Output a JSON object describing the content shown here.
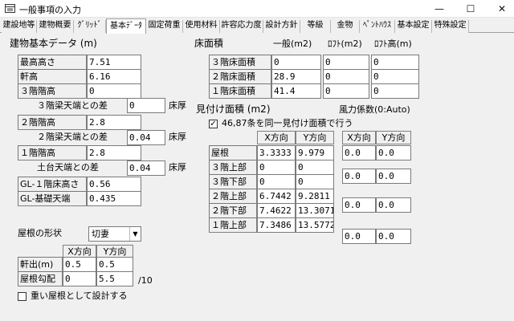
{
  "window": {
    "title": "一般事項の入力",
    "minimize": "—",
    "maximize": "☐",
    "close": "✕"
  },
  "tabs": [
    "建設地等",
    "建物概要",
    "ｸﾞﾘｯﾄﾞ",
    "基本ﾃﾞｰﾀ",
    "固定荷重",
    "使用材料",
    "許容応力度",
    "設計方針",
    "等級",
    "金物",
    "ﾍﾟﾝﾄﾊｳｽ",
    "基本設定",
    "特殊設定"
  ],
  "basic": {
    "heading": "建物基本データ (m)",
    "max_height_label": "最高高さ",
    "max_height": "7.51",
    "eave_height_label": "軒高",
    "eave_height": "6.16",
    "f3_height_label": "３階階高",
    "f3_height": "0",
    "f3_beam_diff_label": "３階梁天端との差",
    "f3_beam_diff": "0",
    "f3_beam_unit": "床厚",
    "f2_height_label": "２階階高",
    "f2_height": "2.8",
    "f2_beam_diff_label": "２階梁天端との差",
    "f2_beam_diff": "0.04",
    "f2_beam_unit": "床厚",
    "f1_height_label": "１階階高",
    "f1_height": "2.8",
    "sill_diff_label": "土台天端との差",
    "sill_diff": "0.04",
    "sill_unit": "床厚",
    "gl_f1_label": "GL-１階床高さ",
    "gl_f1": "0.56",
    "gl_base_label": "GL-基礎天端",
    "gl_base": "0.435"
  },
  "floor_area": {
    "heading": "床面積",
    "col_general": "一般(m2)",
    "col_loft": "ﾛﾌﾄ(m2)",
    "col_loft_height": "ﾛﾌﾄ高(m)",
    "rows": [
      {
        "label": "３階床面積",
        "general": "0",
        "loft": "0",
        "loft_height": "0"
      },
      {
        "label": "２階床面積",
        "general": "28.9",
        "loft": "0",
        "loft_height": "0"
      },
      {
        "label": "１階床面積",
        "general": "41.4",
        "loft": "0",
        "loft_height": "0"
      }
    ]
  },
  "projected": {
    "heading": "見付け面積 (m2)",
    "wind_label": "風力係数(0:Auto)",
    "same_checkbox_checked": true,
    "same_checkbox_label": "46,87条を同一見付け面積で行う",
    "col_x": "X方向",
    "col_y": "Y方向",
    "wind_col_x": "X方向",
    "wind_col_y": "Y方向",
    "rows": [
      {
        "label": "屋根",
        "x": "3.3333",
        "y": "9.979"
      },
      {
        "label": "３階上部",
        "x": "0",
        "y": "0"
      },
      {
        "label": "３階下部",
        "x": "0",
        "y": "0"
      },
      {
        "label": "２階上部",
        "x": "6.7442",
        "y": "9.2811"
      },
      {
        "label": "２階下部",
        "x": "7.4622",
        "y": "13.3071"
      },
      {
        "label": "１階上部",
        "x": "7.3486",
        "y": "13.5772"
      }
    ],
    "wind": [
      {
        "x": "0.0",
        "y": "0.0"
      },
      {
        "x": "0.0",
        "y": "0.0"
      },
      {
        "x": "0.0",
        "y": "0.0"
      },
      {
        "x": "0.0",
        "y": "0.0"
      }
    ]
  },
  "roof": {
    "shape_label": "屋根の形状",
    "shape_value": "切妻",
    "col_x": "X方向",
    "col_y": "Y方向",
    "overhang_label": "軒出(m)",
    "overhang_x": "0.5",
    "overhang_y": "0.5",
    "pitch_label": "屋根勾配",
    "pitch_x": "0",
    "pitch_y": "5.5",
    "pitch_unit": "/10",
    "heavy_checked": false,
    "heavy_label": "重い屋根として設計する"
  }
}
